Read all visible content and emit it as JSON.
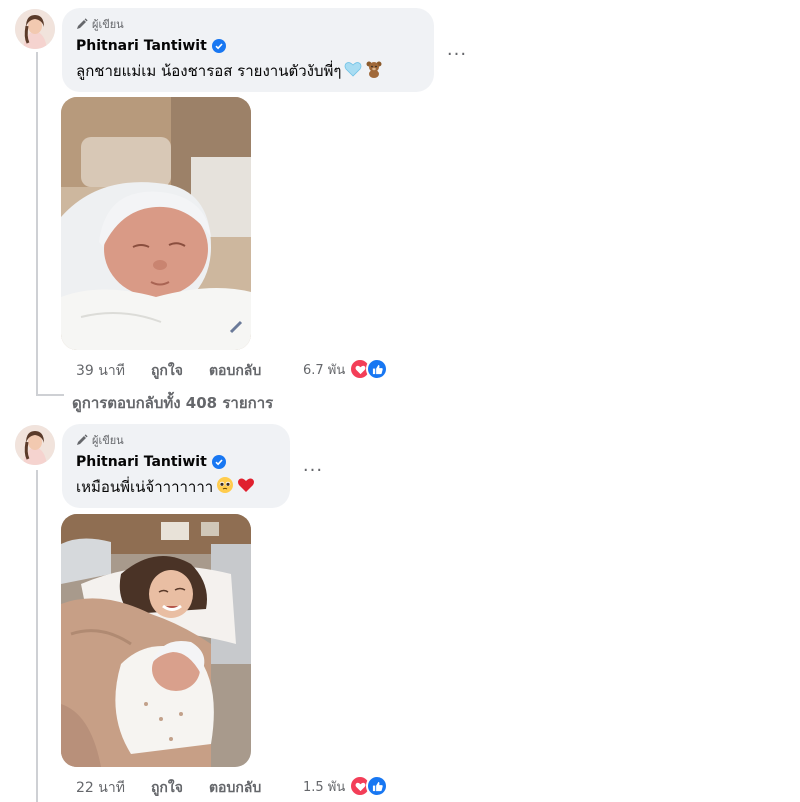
{
  "comments": [
    {
      "badge": "ผู้เขียน",
      "author": "Phitnari Tantiwit",
      "text": "ลูกชายแม่เม น้องชารอส รายงานตัวงับพี่ๆ",
      "emojis": [
        "light-blue-heart",
        "teddy-bear"
      ],
      "more": "...",
      "time": "39 นาที",
      "like_label": "ถูกใจ",
      "reply_label": "ตอบกลับ",
      "reaction_count": "6.7 พัน",
      "photo": "newborn-baby-sleeping-photo"
    },
    {
      "badge": "ผู้เขียน",
      "author": "Phitnari Tantiwit",
      "text": "เหมือนพี่เน่จ้าาาาาาา",
      "emojis": [
        "pleading-face",
        "red-heart"
      ],
      "more": "...",
      "time": "22 นาที",
      "like_label": "ถูกใจ",
      "reply_label": "ตอบกลับ",
      "reaction_count": "1.5 พัน",
      "photo": "mother-with-newborn-in-hospital-bed-photo"
    }
  ],
  "view_replies": "ดูการตอบกลับทั้ง 408 รายการ",
  "colors": {
    "bubble": "#f0f2f5",
    "secondary_text": "#65676b",
    "verified": "#1877f2",
    "love": "#f33e58",
    "like": "#1877f2"
  }
}
